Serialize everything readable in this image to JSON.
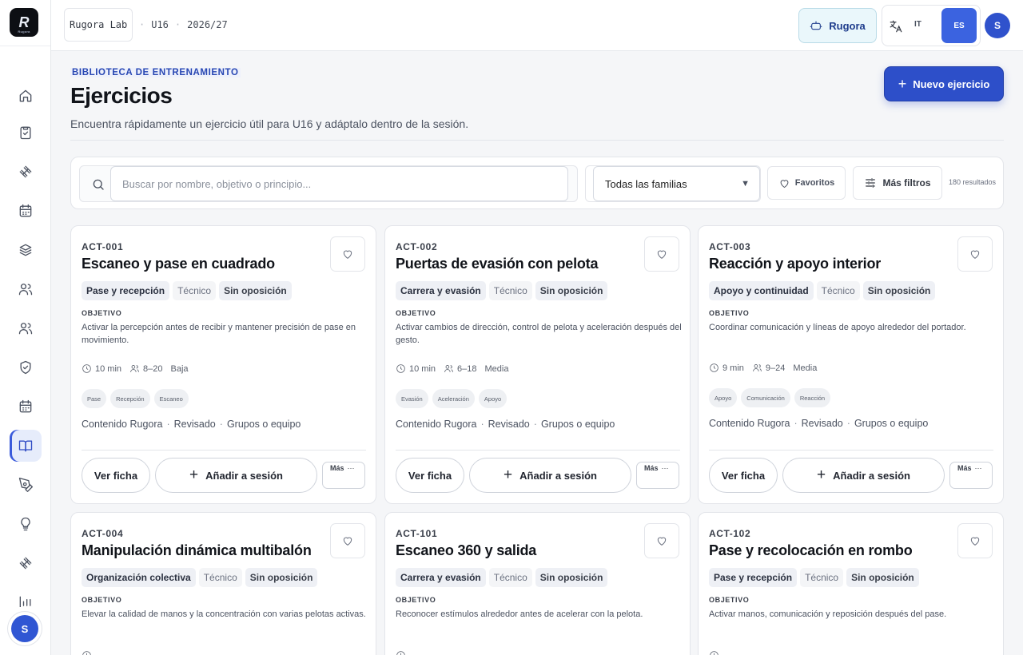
{
  "brand": {
    "logo_letter": "R",
    "logo_sub": "Rugora"
  },
  "topbar": {
    "context_name": "Rugora Lab",
    "category": "U16",
    "season": "2026/27",
    "assistant_label": "Rugora",
    "lang_it": "IT",
    "lang_es": "ES",
    "avatar_initial": "S"
  },
  "sidebar": {
    "avatar_initial": "S",
    "items": [
      {
        "icon": "home-icon"
      },
      {
        "icon": "clipboard-check-icon"
      },
      {
        "icon": "dumbbell-icon"
      },
      {
        "icon": "calendar-icon"
      },
      {
        "icon": "layers-icon"
      },
      {
        "icon": "users-icon"
      },
      {
        "icon": "team-icon"
      },
      {
        "icon": "shield-check-icon"
      },
      {
        "icon": "schedule-icon"
      },
      {
        "icon": "book-open-icon"
      },
      {
        "icon": "pen-tool-icon"
      },
      {
        "icon": "lightbulb-icon"
      },
      {
        "icon": "drill-icon"
      },
      {
        "icon": "bar-chart-icon"
      }
    ]
  },
  "header": {
    "eyebrow": "BIBLIOTECA DE ENTRENAMIENTO",
    "title": "Ejercicios",
    "subtitle": "Encuentra rápidamente un ejercicio útil para U16 y adáptalo dentro de la sesión.",
    "new_button": "Nuevo ejercicio"
  },
  "filters": {
    "search_placeholder": "Buscar por nombre, objetivo o principio...",
    "family_selected": "Todas las familias",
    "favorites": "Favoritos",
    "more_filters": "Más filtros",
    "results": "180 resultados"
  },
  "card_labels": {
    "objective": "OBJETIVO",
    "view": "Ver ficha",
    "add": "Añadir a sesión",
    "more": "Más",
    "more_dots": "···"
  },
  "exercises": [
    {
      "code": "ACT-001",
      "title": "Escaneo y pase en cuadrado",
      "family": "Pase y recepción",
      "type": "Técnico",
      "opposition": "Sin oposición",
      "objective": "Activar la percepción antes de recibir y mantener precisión de pase en movimiento.",
      "duration": "10 min",
      "players": "8–20",
      "intensity": "Baja",
      "chips": [
        "Pase",
        "Recepción",
        "Escaneo"
      ],
      "source": "Contenido Rugora",
      "status": "Revisado",
      "format": "Grupos o equipo"
    },
    {
      "code": "ACT-002",
      "title": "Puertas de evasión con pelota",
      "family": "Carrera y evasión",
      "type": "Técnico",
      "opposition": "Sin oposición",
      "objective": "Activar cambios de dirección, control de pelota y aceleración después del gesto.",
      "duration": "10 min",
      "players": "6–18",
      "intensity": "Media",
      "chips": [
        "Evasión",
        "Aceleración",
        "Apoyo"
      ],
      "source": "Contenido Rugora",
      "status": "Revisado",
      "format": "Grupos o equipo"
    },
    {
      "code": "ACT-003",
      "title": "Reacción y apoyo interior",
      "family": "Apoyo y continuidad",
      "type": "Técnico",
      "opposition": "Sin oposición",
      "objective": "Coordinar comunicación y líneas de apoyo alrededor del portador.",
      "duration": "9 min",
      "players": "9–24",
      "intensity": "Media",
      "chips": [
        "Apoyo",
        "Comunicación",
        "Reacción"
      ],
      "source": "Contenido Rugora",
      "status": "Revisado",
      "format": "Grupos o equipo"
    },
    {
      "code": "ACT-004",
      "title": "Manipulación dinámica multibalón",
      "family": "Organización colectiva",
      "type": "Técnico",
      "opposition": "Sin oposición",
      "objective": "Elevar la calidad de manos y la concentración con varias pelotas activas."
    },
    {
      "code": "ACT-101",
      "title": "Escaneo 360 y salida",
      "family": "Carrera y evasión",
      "type": "Técnico",
      "opposition": "Sin oposición",
      "objective": "Reconocer estímulos alrededor antes de acelerar con la pelota."
    },
    {
      "code": "ACT-102",
      "title": "Pase y recolocación en rombo",
      "family": "Pase y recepción",
      "type": "Técnico",
      "opposition": "Sin oposición",
      "objective": "Activar manos, comunicación y reposición después del pase."
    }
  ]
}
